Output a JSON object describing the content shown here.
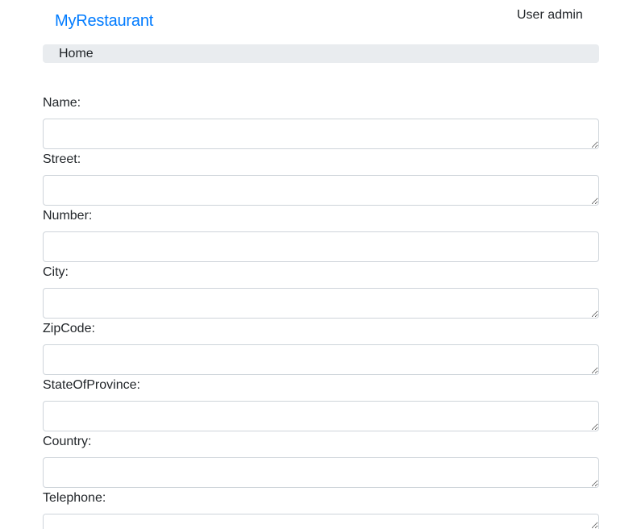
{
  "navbar": {
    "brand": "MyRestaurant",
    "user_label": "User admin"
  },
  "breadcrumb": {
    "items": [
      {
        "label": "Home"
      }
    ]
  },
  "form": {
    "fields": [
      {
        "label": "Name:",
        "value": "",
        "kind": "textarea"
      },
      {
        "label": "Street:",
        "value": "",
        "kind": "textarea"
      },
      {
        "label": "Number:",
        "value": "",
        "kind": "input"
      },
      {
        "label": "City:",
        "value": "",
        "kind": "textarea"
      },
      {
        "label": "ZipCode:",
        "value": "",
        "kind": "textarea"
      },
      {
        "label": "StateOfProvince:",
        "value": "",
        "kind": "textarea"
      },
      {
        "label": "Country:",
        "value": "",
        "kind": "textarea"
      },
      {
        "label": "Telephone:",
        "value": "",
        "kind": "textarea"
      }
    ]
  },
  "colors": {
    "brand": "#007bff",
    "breadcrumb_bg": "#e9ecef",
    "input_border": "#ced4da",
    "text": "#212529"
  }
}
